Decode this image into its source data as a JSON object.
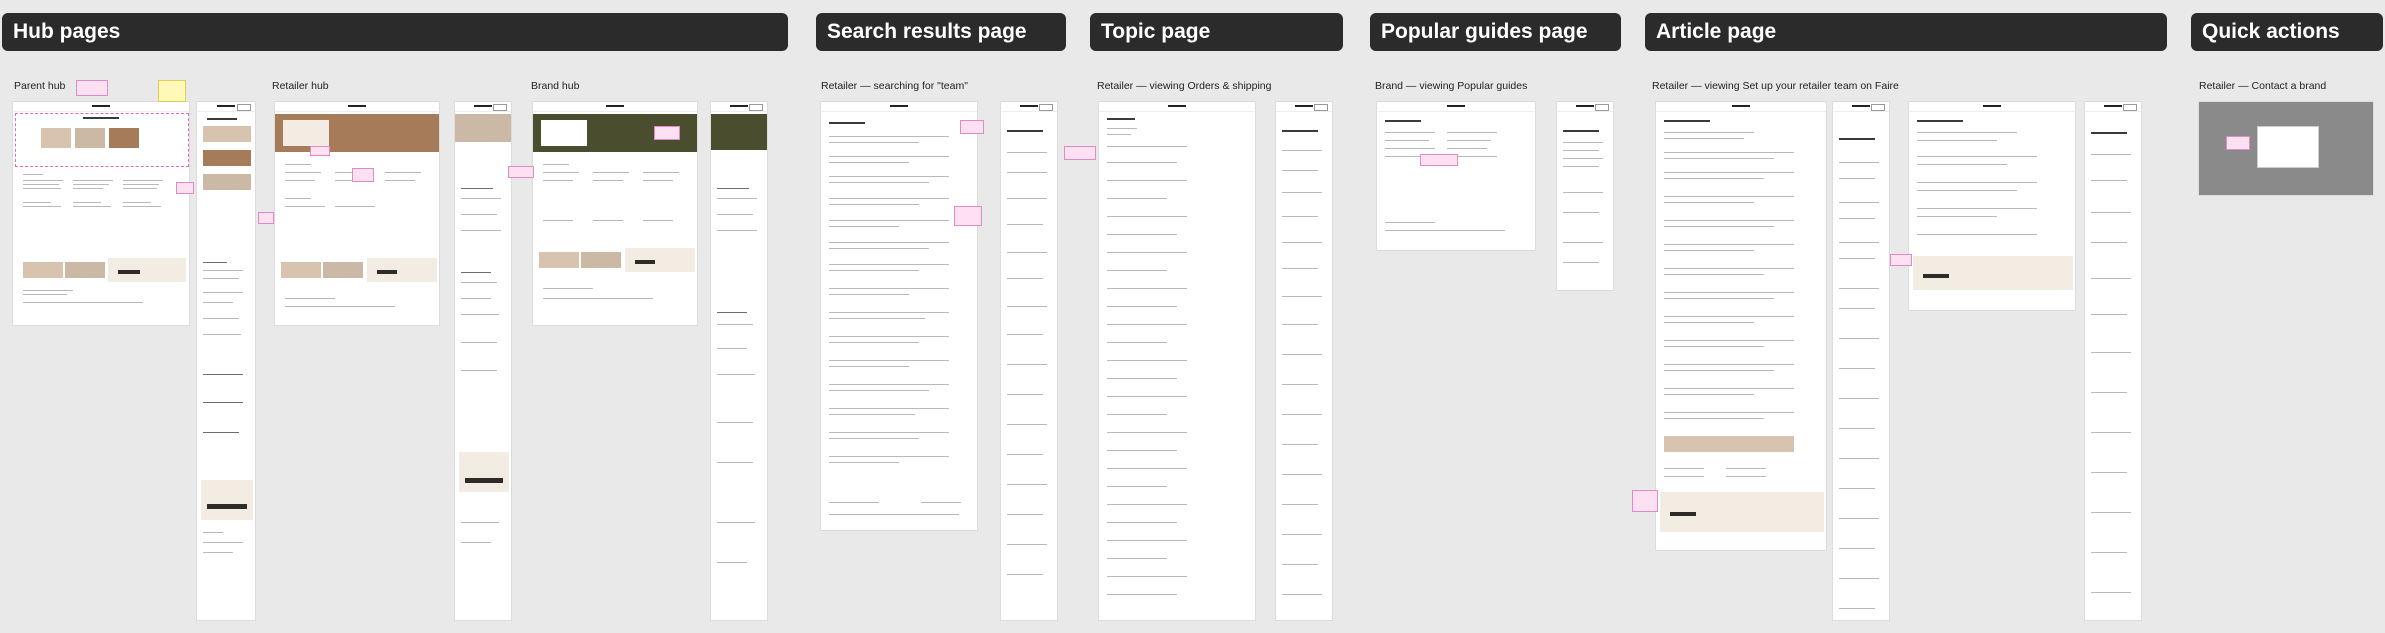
{
  "sections": {
    "hub": {
      "title": "Hub pages"
    },
    "search": {
      "title": "Search results page"
    },
    "topic": {
      "title": "Topic page"
    },
    "popular": {
      "title": "Popular guides page"
    },
    "article": {
      "title": "Article page"
    },
    "quick": {
      "title": "Quick actions"
    }
  },
  "frames": {
    "parent_hub": {
      "label": "Parent hub"
    },
    "retailer_hub": {
      "label": "Retailer hub"
    },
    "brand_hub": {
      "label": "Brand hub"
    },
    "search_results": {
      "label": "Retailer — searching for \"team\""
    },
    "topic": {
      "label": "Retailer — viewing Orders & shipping"
    },
    "popular": {
      "label": "Brand — viewing Popular guides"
    },
    "article": {
      "label": "Retailer — viewing Set up your retailer team on Faire"
    },
    "quick": {
      "label": "Retailer — Contact a brand"
    }
  },
  "colors": {
    "banner": "#2b2b2b",
    "annotation": "#fde0f2",
    "sticky": "#fff8b8",
    "canvas": "#e9e9e9"
  }
}
